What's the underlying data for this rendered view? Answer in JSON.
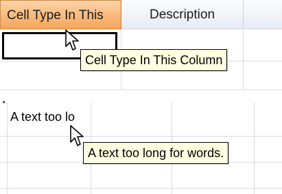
{
  "top_grid": {
    "columns": [
      {
        "label": "Cell Type In This",
        "state": "active"
      },
      {
        "label": "Description",
        "state": "normal"
      },
      {
        "label": "",
        "state": "normal"
      }
    ],
    "tooltip": "Cell Type In This Column",
    "cursor_icon": "arrow-pointer-icon"
  },
  "bottom_grid": {
    "cell_text": "A text too lo",
    "tooltip": "A text too long for words.",
    "cursor_icon": "arrow-pointer-icon"
  },
  "colors": {
    "header_active_top": "#fbd3a7",
    "header_active_bottom": "#f6a55a",
    "header_normal_top": "#fbfcfe",
    "header_normal_bottom": "#e7ecf4",
    "gridline": "#d7dbe2",
    "tooltip_background": "#ffffe1"
  }
}
